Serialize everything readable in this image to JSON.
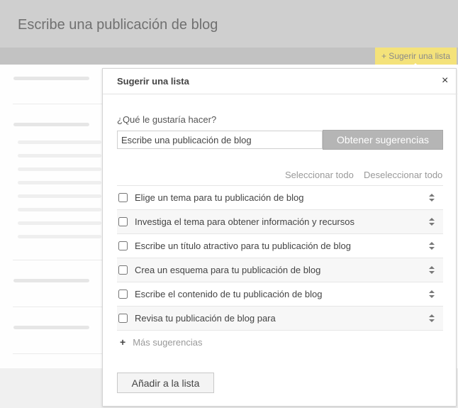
{
  "background": {
    "title": "Escribe una publicación de blog"
  },
  "suggest_trigger": {
    "label": "+ Sugerir una lista"
  },
  "popover": {
    "title": "Sugerir una lista",
    "close_label": "×",
    "question": "¿Qué le gustaría hacer?",
    "input_value": "Escribe una publicación de blog",
    "get_suggestions_label": "Obtener sugerencias",
    "select_all_label": "Seleccionar todo",
    "deselect_all_label": "Deseleccionar todo",
    "items": [
      {
        "label": "Elige un tema para tu publicación de blog",
        "checked": false
      },
      {
        "label": "Investiga el tema para obtener información y recursos",
        "checked": false
      },
      {
        "label": "Escribe un título atractivo para tu publicación de blog",
        "checked": false
      },
      {
        "label": "Crea un esquema para tu publicación de blog",
        "checked": false
      },
      {
        "label": "Escribe el contenido de tu publicación de blog",
        "checked": false
      },
      {
        "label": "Revisa tu publicación de blog para",
        "checked": false
      }
    ],
    "more_icon": "plus-icon",
    "more_label": "Más sugerencias",
    "add_button_label": "Añadir a la lista"
  },
  "colors": {
    "trigger_highlight": "#f4e27a",
    "primary_button": "#b5b5b5"
  }
}
